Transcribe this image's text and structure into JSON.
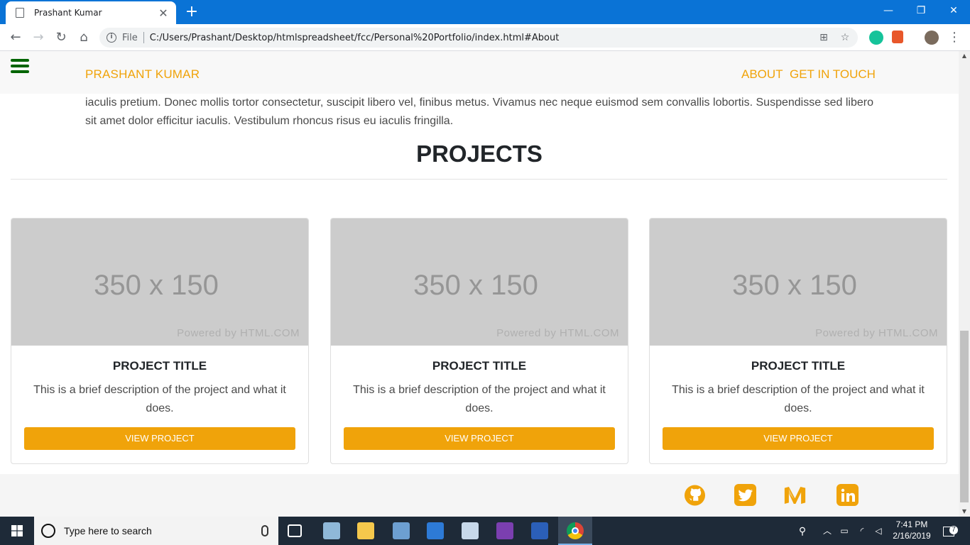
{
  "browser": {
    "tab_title": "Prashant Kumar",
    "tab_close": "✕",
    "new_tab": "+",
    "file_label": "File",
    "url": "C:/Users/Prashant/Desktop/htmlspreadsheet/fcc/Personal%20Portfolio/index.html#About"
  },
  "page": {
    "brand": "PRASHANT KUMAR",
    "nav": {
      "about": "ABOUT",
      "contact": "GET IN TOUCH"
    },
    "about_text": "iaculis pretium. Donec mollis tortor consectetur, suscipit libero vel, finibus metus. Vivamus nec neque euismod sem convallis lobortis. Suspendisse sed libero sit amet dolor efficitur iaculis. Vestibulum rhoncus risus eu iaculis fringilla.",
    "projects_heading": "PROJECTS",
    "projects": [
      {
        "img_size": "350 x 150",
        "img_powered": "Powered by HTML.COM",
        "title": "PROJECT TITLE",
        "desc": "This is a brief description of the project and what it does.",
        "button": "VIEW PROJECT"
      },
      {
        "img_size": "350 x 150",
        "img_powered": "Powered by HTML.COM",
        "title": "PROJECT TITLE",
        "desc": "This is a brief description of the project and what it does.",
        "button": "VIEW PROJECT"
      },
      {
        "img_size": "350 x 150",
        "img_powered": "Powered by HTML.COM",
        "title": "PROJECT TITLE",
        "desc": "This is a brief description of the project and what it does.",
        "button": "VIEW PROJECT"
      }
    ],
    "social_icons": [
      "github-icon",
      "twitter-icon",
      "medium-icon",
      "linkedin-icon"
    ],
    "accent_color": "#f0a30a"
  },
  "taskbar": {
    "search_placeholder": "Type here to search",
    "time": "7:41 PM",
    "date": "2/16/2019",
    "notification_count": "7"
  }
}
